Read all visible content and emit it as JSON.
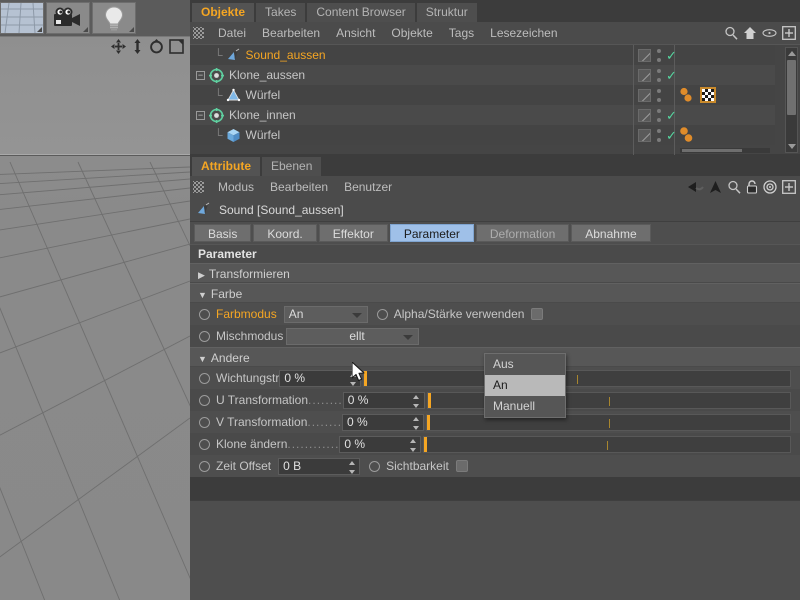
{
  "left_toolbar": {
    "buttons": [
      {
        "name": "render-view-button",
        "icon": "render-grid-icon"
      },
      {
        "name": "camera-button",
        "icon": "camera-icon"
      },
      {
        "name": "light-button",
        "icon": "light-bulb-icon"
      }
    ]
  },
  "viewport": {
    "axis_icons": [
      "move-icon",
      "scale-icon",
      "rotate-icon",
      "render-region-icon"
    ]
  },
  "object_manager": {
    "tabs": [
      {
        "label": "Objekte",
        "active": true
      },
      {
        "label": "Takes",
        "active": false
      },
      {
        "label": "Content Browser",
        "active": false
      },
      {
        "label": "Struktur",
        "active": false
      }
    ],
    "menu": [
      "Datei",
      "Bearbeiten",
      "Ansicht",
      "Objekte",
      "Tags",
      "Lesezeichen"
    ],
    "menu_icons": [
      "search-icon",
      "home-icon",
      "eye-icon",
      "plus-box-icon"
    ],
    "rows": [
      {
        "name": "Sound_aussen",
        "depth": 1,
        "icon": "sound-effector-icon",
        "selected": true,
        "expander": "",
        "has_check": true,
        "tags": []
      },
      {
        "name": "Klone_aussen",
        "depth": 0,
        "icon": "cloner-icon",
        "selected": false,
        "expander": "-",
        "has_check": true,
        "tags": []
      },
      {
        "name": "Würfel",
        "depth": 1,
        "icon": "polygon-object-icon",
        "selected": false,
        "expander": "",
        "has_check": false,
        "tags": [
          "orange-dot",
          "orange-dot",
          "checker-texture"
        ]
      },
      {
        "name": "Klone_innen",
        "depth": 0,
        "icon": "cloner-icon",
        "selected": false,
        "expander": "-",
        "has_check": true,
        "tags": []
      },
      {
        "name": "Würfel",
        "depth": 1,
        "icon": "cube-icon",
        "selected": false,
        "expander": "",
        "has_check": true,
        "tags": [
          "orange-dot",
          "orange-dot"
        ]
      }
    ]
  },
  "attribute_manager": {
    "tabs": [
      {
        "label": "Attribute",
        "active": true
      },
      {
        "label": "Ebenen",
        "active": false
      }
    ],
    "menu": [
      "Modus",
      "Bearbeiten",
      "Benutzer"
    ],
    "menu_icons": [
      "back-arrow-icon",
      "forward-arrow-icon",
      "up-arrow-icon",
      "search-icon",
      "lock-icon",
      "target-icon",
      "plus-box-icon"
    ],
    "object_title": "Sound [Sound_aussen]",
    "object_icon": "sound-effector-icon",
    "tabs_row": [
      {
        "label": "Basis",
        "active": false
      },
      {
        "label": "Koord.",
        "active": false
      },
      {
        "label": "Effektor",
        "active": false
      },
      {
        "label": "Parameter",
        "active": true
      },
      {
        "label": "Deformation",
        "active": false,
        "dim": true
      },
      {
        "label": "Abnahme",
        "active": false
      }
    ],
    "section_title": "Parameter",
    "groups": [
      {
        "label": "Transformieren",
        "expanded": false
      },
      {
        "label": "Farbe",
        "expanded": true
      },
      {
        "label": "Andere",
        "expanded": true
      }
    ],
    "farbe_rows": [
      {
        "label": "Farbmodus",
        "highlight": true,
        "control": "combo",
        "value": "An",
        "extra_label": "Alpha/Stärke verwenden",
        "extra_control": "checkbox",
        "extra_checked": false
      },
      {
        "label": "Mischmodus",
        "highlight": false,
        "control": "combo",
        "value": "ellt"
      }
    ],
    "andere_rows": [
      {
        "label": "Wichtungstr",
        "dots": "",
        "value": "0 %",
        "slider": true
      },
      {
        "label": "U Transformation",
        "dots": "........",
        "value": "0 %",
        "slider": true
      },
      {
        "label": "V Transformation",
        "dots": "........",
        "value": "0 %",
        "slider": true
      },
      {
        "label": "Klone ändern",
        "dots": "............",
        "value": "0 %",
        "slider": true
      }
    ],
    "last_row": {
      "label": "Zeit Offset",
      "value": "0 B",
      "extra_label": "Sichtbarkeit",
      "extra_checked": false
    }
  },
  "dropdown_popup": {
    "items": [
      {
        "label": "Aus",
        "hovered": false
      },
      {
        "label": "An",
        "hovered": true
      },
      {
        "label": "Manuell",
        "hovered": false
      }
    ]
  },
  "colors": {
    "accent_orange": "#f5a623",
    "tab_active_blue": "#9fc0e8",
    "check_green": "#55d6a0",
    "panel_bg": "#4e4e4e",
    "tree_bg": "#454545"
  }
}
